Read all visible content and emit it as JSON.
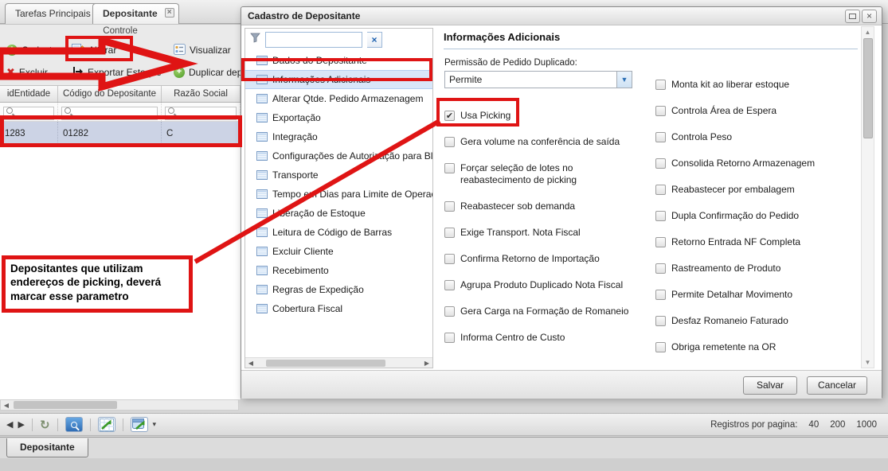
{
  "window": {
    "top_tabs": [
      {
        "label": "Tarefas Principais"
      },
      {
        "label": "Depositante"
      }
    ],
    "toolbar": {
      "group_label": "Controle",
      "buttons": [
        {
          "label": "Cadastrar"
        },
        {
          "label": "Alterar"
        },
        {
          "label": "Visualizar"
        },
        {
          "label": "Excluir"
        },
        {
          "label": "Exportar Estoque"
        },
        {
          "label": "Duplicar deposit"
        }
      ]
    },
    "grid": {
      "columns": [
        "idEntidade",
        "Código do Depositante",
        "Razão Social"
      ],
      "row": {
        "id_entidade": "1283",
        "codigo": "01282",
        "razao_social": "C"
      }
    },
    "pager": {
      "records_label": "Registros por pagina:",
      "page_sizes": [
        "40",
        "200",
        "1000"
      ]
    },
    "bottom_tab": {
      "label": "Depositante"
    }
  },
  "dialog": {
    "title": "Cadastro de Depositante",
    "filter_value": "",
    "tree": {
      "selected": "Informações Adicionais",
      "items": [
        "Dados do Depositante",
        "Informações Adicionais",
        "Alterar Qtde. Pedido Armazenagem",
        "Exportação",
        "Integração",
        "Configurações de Autorização para Bloqu",
        "Transporte",
        "Tempo em Dias para Limite de Operação",
        "Liberação de Estoque",
        "Leitura de Código de Barras",
        "Excluir Cliente",
        "Recebimento",
        "Regras de Expedição",
        "Cobertura Fiscal"
      ]
    },
    "content": {
      "heading": "Informações Adicionais",
      "duplicate_permission_label": "Permissão de Pedido Duplicado:",
      "duplicate_permission_value": "Permite",
      "left_checkboxes": [
        {
          "label": "Usa Picking",
          "checked": true,
          "mark": "✔"
        },
        {
          "label": "Gera volume na conferência de saída",
          "checked": false,
          "mark": ""
        },
        {
          "label": "Forçar seleção de lotes no reabastecimento de picking",
          "checked": false,
          "mark": ""
        },
        {
          "label": "Reabastecer sob demanda",
          "checked": false,
          "mark": ""
        },
        {
          "label": "Exige Transport. Nota Fiscal",
          "checked": false,
          "mark": ""
        },
        {
          "label": "Confirma Retorno de Importação",
          "checked": false,
          "mark": ""
        },
        {
          "label": "Agrupa Produto Duplicado Nota Fiscal",
          "checked": false,
          "mark": ""
        },
        {
          "label": "Gera Carga na Formação de Romaneio",
          "checked": false,
          "mark": ""
        },
        {
          "label": "Informa Centro de Custo",
          "checked": false,
          "mark": ""
        }
      ],
      "right_checkboxes": [
        {
          "label": "Monta kit ao liberar estoque",
          "checked": false,
          "mark": ""
        },
        {
          "label": "Controla Área de Espera",
          "checked": false,
          "mark": ""
        },
        {
          "label": "Controla Peso",
          "checked": false,
          "mark": ""
        },
        {
          "label": "Consolida Retorno Armazenagem",
          "checked": false,
          "mark": ""
        },
        {
          "label": "Reabastecer por embalagem",
          "checked": false,
          "mark": ""
        },
        {
          "label": "Dupla Confirmação do Pedido",
          "checked": false,
          "mark": ""
        },
        {
          "label": "Retorno Entrada NF Completa",
          "checked": false,
          "mark": ""
        },
        {
          "label": "Rastreamento de Produto",
          "checked": false,
          "mark": ""
        },
        {
          "label": "Permite Detalhar Movimento",
          "checked": false,
          "mark": ""
        },
        {
          "label": "Desfaz Romaneio Faturado",
          "checked": false,
          "mark": ""
        },
        {
          "label": "Obriga remetente na OR",
          "checked": false,
          "mark": ""
        }
      ]
    },
    "footer": {
      "save_label": "Salvar",
      "cancel_label": "Cancelar"
    }
  },
  "annotations": {
    "color": "#df1414",
    "note": "Depositantes que utilizam endereços de picking, deverá marcar esse parametro"
  },
  "icons": {
    "tab_close": "×",
    "window_close": "×",
    "clear_filter": "×",
    "combo_arrow": "▼",
    "nav_prev": "◀",
    "nav_next": "▶",
    "refresh": "↻",
    "dropdown_caret": "▾",
    "scroll_up": "▲",
    "scroll_down": "▼",
    "scroll_left": "◀",
    "scroll_right": "▶"
  }
}
